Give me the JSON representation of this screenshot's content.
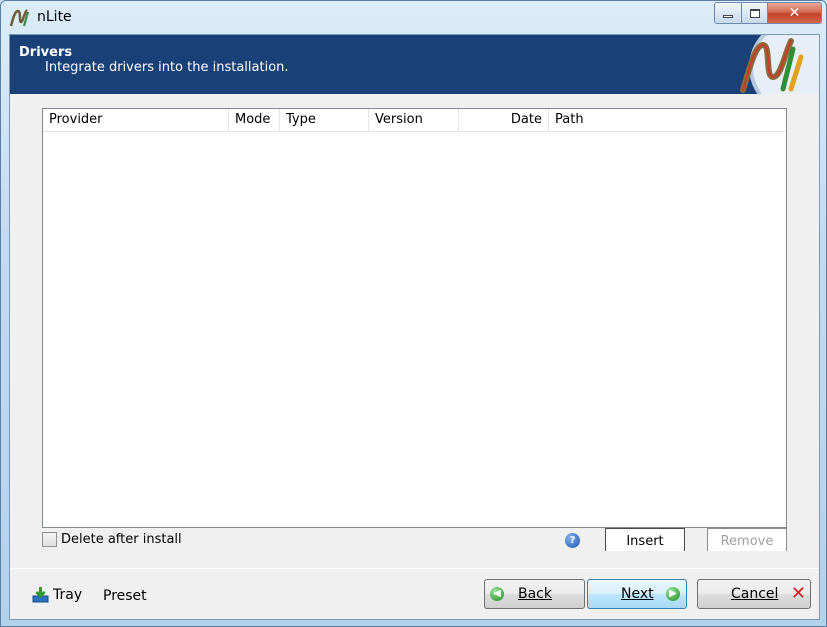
{
  "window": {
    "title": "nLite",
    "icon": "nlite-logo-icon",
    "min_icon": "minimize-icon",
    "max_icon": "maximize-icon",
    "close_icon": "close-icon"
  },
  "header": {
    "title": "Drivers",
    "subtitle": "Integrate drivers into the installation.",
    "logo": "nlite-logo"
  },
  "listview": {
    "columns": [
      "Provider",
      "Mode",
      "Type",
      "Version",
      "Date",
      "Path"
    ],
    "rows": []
  },
  "options": {
    "delete_after_install_label": "Delete after install",
    "delete_after_install_checked": false,
    "help_icon": "help-icon",
    "help_glyph": "?"
  },
  "actions": {
    "insert_label": "Insert",
    "remove_label": "Remove",
    "remove_enabled": false
  },
  "footer": {
    "tray_label": "Tray",
    "tray_icon": "tray-download-icon",
    "preset_label": "Preset",
    "back_label": "Back",
    "back_icon": "back-arrow-icon",
    "next_label": "Next",
    "next_icon": "next-arrow-icon",
    "cancel_label": "Cancel",
    "cancel_icon": "cancel-x-icon"
  },
  "colors": {
    "header_bg": "#1a4078",
    "accent_green": "#1c8b1c",
    "cancel_red": "#cc1f1f"
  }
}
